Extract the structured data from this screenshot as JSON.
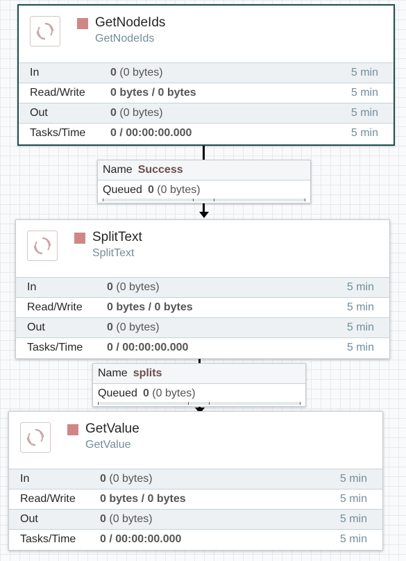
{
  "processors": [
    {
      "name": "GetNodeIds",
      "type": "GetNodeIds",
      "status_color": "#d18686",
      "icon": "processor-icon",
      "stats": {
        "in": {
          "label": "In",
          "count": "0",
          "size": "(0 bytes)",
          "time": "5 min"
        },
        "rw": {
          "label": "Read/Write",
          "value": "0 bytes / 0 bytes",
          "time": "5 min"
        },
        "out": {
          "label": "Out",
          "count": "0",
          "size": "(0 bytes)",
          "time": "5 min"
        },
        "tasks": {
          "label": "Tasks/Time",
          "value": "0 / 00:00:00.000",
          "time": "5 min"
        }
      }
    },
    {
      "name": "SplitText",
      "type": "SplitText",
      "status_color": "#d18686",
      "icon": "processor-icon",
      "stats": {
        "in": {
          "label": "In",
          "count": "0",
          "size": "(0 bytes)",
          "time": "5 min"
        },
        "rw": {
          "label": "Read/Write",
          "value": "0 bytes / 0 bytes",
          "time": "5 min"
        },
        "out": {
          "label": "Out",
          "count": "0",
          "size": "(0 bytes)",
          "time": "5 min"
        },
        "tasks": {
          "label": "Tasks/Time",
          "value": "0 / 00:00:00.000",
          "time": "5 min"
        }
      }
    },
    {
      "name": "GetValue",
      "type": "GetValue",
      "status_color": "#d18686",
      "icon": "processor-icon",
      "stats": {
        "in": {
          "label": "In",
          "count": "0",
          "size": "(0 bytes)",
          "time": "5 min"
        },
        "rw": {
          "label": "Read/Write",
          "value": "0 bytes / 0 bytes",
          "time": "5 min"
        },
        "out": {
          "label": "Out",
          "count": "0",
          "size": "(0 bytes)",
          "time": "5 min"
        },
        "tasks": {
          "label": "Tasks/Time",
          "value": "0 / 00:00:00.000",
          "time": "5 min"
        }
      }
    }
  ],
  "connections": [
    {
      "name_label": "Name",
      "name": "Success",
      "queued_label": "Queued",
      "queued_count": "0",
      "queued_size": "(0 bytes)"
    },
    {
      "name_label": "Name",
      "name": "splits",
      "queued_label": "Queued",
      "queued_count": "0",
      "queued_size": "(0 bytes)"
    }
  ]
}
